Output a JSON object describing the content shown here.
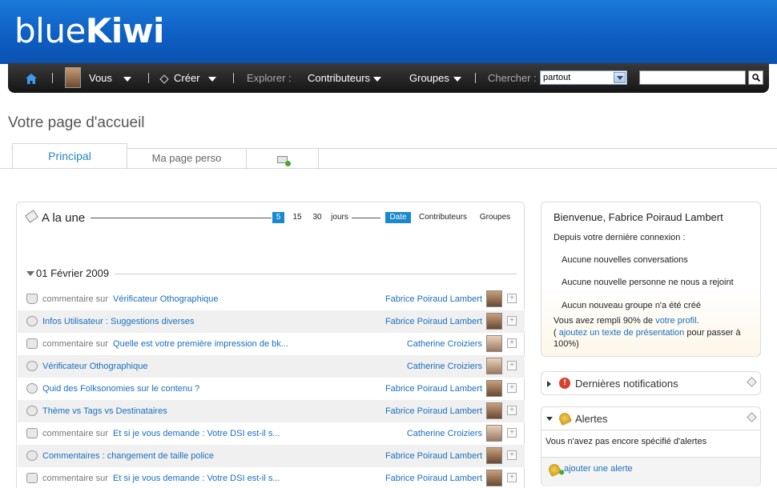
{
  "brand": {
    "logo_part1": "blue",
    "logo_part2": "Kiwi"
  },
  "nav": {
    "vous": "Vous",
    "creer": "Créer",
    "explorer": "Explorer :",
    "contributeurs": "Contributeurs",
    "groupes": "Groupes",
    "chercher": "Chercher :",
    "scope_selected": "partout",
    "search_value": ""
  },
  "page": {
    "title": "Votre page d'accueil"
  },
  "tabs": [
    {
      "label": "Principal"
    },
    {
      "label": "Ma page perso"
    }
  ],
  "feed": {
    "title": "A la une",
    "period_filters": [
      "5",
      "15",
      "30"
    ],
    "period_active": "5",
    "period_unit": "jours",
    "sort_filters": [
      "Date",
      "Contributeurs",
      "Groupes"
    ],
    "sort_active": "Date",
    "date_header": "01 Février 2009",
    "rows": [
      {
        "icon": "thumb-up-icon",
        "prefix": "commentaire sur",
        "link": "Vérificateur Othographique",
        "author": "Fabrice Poiraud Lambert",
        "avatar": "male"
      },
      {
        "icon": "idea-icon",
        "prefix": "",
        "link": "Infos Utilisateur : Suggestions diverses",
        "author": "Fabrice Poiraud Lambert",
        "avatar": "male"
      },
      {
        "icon": "comment-icon",
        "prefix": "commentaire sur",
        "link": "Quelle est votre première impression de bk...",
        "author": "Catherine Croiziers",
        "avatar": "female"
      },
      {
        "icon": "idea-icon",
        "prefix": "",
        "link": "Vérificateur Othographique",
        "author": "Catherine Croiziers",
        "avatar": "female"
      },
      {
        "icon": "idea-icon",
        "prefix": "",
        "link": "Quid des Folksonomies sur le contenu ?",
        "author": "Fabrice Poiraud Lambert",
        "avatar": "male"
      },
      {
        "icon": "idea-icon",
        "prefix": "",
        "link": "Thème vs Tags vs Destinataires",
        "author": "Fabrice Poiraud Lambert",
        "avatar": "male"
      },
      {
        "icon": "comment-icon",
        "prefix": "commentaire sur",
        "link": "Et si je vous demande : Votre DSI est-il s...",
        "author": "Catherine Croiziers",
        "avatar": "female"
      },
      {
        "icon": "idea-icon",
        "prefix": "",
        "link": "Commentaires : changement de taille police",
        "author": "Fabrice Poiraud Lambert",
        "avatar": "male"
      },
      {
        "icon": "comment-icon",
        "prefix": "commentaire sur",
        "link": "Et si je vous demande : Votre DSI est-il s...",
        "author": "Fabrice Poiraud Lambert",
        "avatar": "male"
      }
    ]
  },
  "welcome": {
    "title": "Bienvenue, Fabrice Poiraud Lambert",
    "since": "Depuis votre dernière connexion :",
    "items": [
      "Aucune nouvelles conversations",
      "Aucune nouvelle personne ne nous a rejoint",
      "Aucun nouveau groupe n'a été créé"
    ],
    "profile_prefix": "Vous avez rempli 90% de ",
    "profile_link": "votre profil",
    "profile_suffix": ".",
    "pres_open": "( ",
    "pres_link": "ajoutez un texte de présentation",
    "pres_suffix": " pour passer à",
    "pres_end": "100%)"
  },
  "notifications": {
    "title": "Dernières notifications"
  },
  "alerts": {
    "title": "Alertes",
    "none": "Vous n'avez pas encore spécifié d'alertes",
    "add": "ajouter une alerte"
  }
}
